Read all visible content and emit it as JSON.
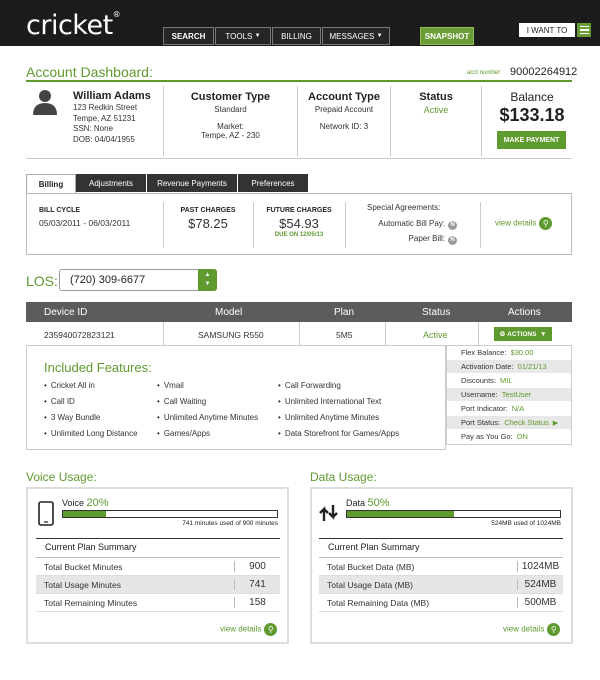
{
  "header": {
    "logo": "cricket",
    "logo_mark": "®",
    "nav": [
      "SEARCH",
      "TOOLS",
      "BILLING",
      "MESSAGES"
    ],
    "snapshot": "SNAPSHOT",
    "i_want_to": "I WANT TO",
    "tools_caret": "▼",
    "messages_caret": "▼"
  },
  "dashboard": {
    "title": "Account Dashboard:",
    "acct_label": "acct number:",
    "acct_number": "90002264912"
  },
  "customer": {
    "name": "William Adams",
    "street": "123 Redkin Street",
    "city": "Tempe, AZ 51231",
    "ssn": "SSN: None",
    "dob": "DOB: 04/04/1955"
  },
  "customer_type": {
    "label": "Customer Type",
    "value": "Standard",
    "market_label": "Market:",
    "market_value": "Tempe, AZ -  230"
  },
  "account_type": {
    "label": "Account Type",
    "value": "Prepaid Account",
    "network": "Network ID: 3"
  },
  "status": {
    "label": "Status",
    "value": "Active"
  },
  "balance": {
    "label": "Balance",
    "value": "$133.18",
    "button": "MAKE PAYMENT"
  },
  "tabs": [
    "Billing",
    "Adjustments",
    "Revenue Payments",
    "Preferences"
  ],
  "billing": {
    "cycle_label": "BILL CYCLE",
    "cycle_value": "05/03/2011 - 06/03/2011",
    "past_label": "PAST CHARGES",
    "past_value": "$78.25",
    "future_label": "FUTURE CHARGES",
    "future_value": "$54.93",
    "future_due": "DUE ON 12/05/13",
    "special_label": "Special Agreements:",
    "autopay_label": "Automatic Bill Pay:",
    "paper_label": "Paper Bill:",
    "badge": "N",
    "view_details": "view details"
  },
  "los": {
    "label": "LOS:",
    "value": "(720) 309-6677"
  },
  "device_table": {
    "headers": [
      "Device ID",
      "Model",
      "Plan",
      "Status",
      "Actions"
    ],
    "row": {
      "device_id": "235940072823121",
      "model": "SAMSUNG R550",
      "plan": "5M5",
      "status": "Active",
      "action": "ACTIONS"
    }
  },
  "features": {
    "title": "Included Features:",
    "col1": [
      "Cricket All in",
      "Call ID",
      "3 Way Bundle",
      "Unlimited Long Distance"
    ],
    "col2": [
      "Vmail",
      "Call Waiting",
      "Unlimited Anytime Minutes",
      "Games/Apps"
    ],
    "col3": [
      "Call Forwarding",
      "Unlimited International Text",
      "Unlimited Anytime Minutes",
      "Data Storefront for Games/Apps"
    ]
  },
  "side_info": [
    {
      "label": "Flex Balance:",
      "value": "$30.00"
    },
    {
      "label": "Activation Date:",
      "value": "01/21/13"
    },
    {
      "label": "Discounts:",
      "value": "MIL"
    },
    {
      "label": "Username:",
      "value": "TestUser"
    },
    {
      "label": "Port Indicator:",
      "value": "N/A"
    },
    {
      "label": "Port Status:",
      "value": "Check Status"
    },
    {
      "label": "Pay as You Go:",
      "value": "ON"
    }
  ],
  "voice": {
    "title": "Voice Usage:",
    "label": "Voice",
    "percent_text": "20%",
    "percent": 20,
    "caption": "741 minutes used of 900 minutes",
    "summary_title": "Current Plan Summary",
    "rows": [
      {
        "label": "Total Bucket Minutes",
        "value": "900"
      },
      {
        "label": "Total Usage Minutes",
        "value": "741"
      },
      {
        "label": "Total Remaining Minutes",
        "value": "158"
      }
    ],
    "view_details": "view details"
  },
  "data": {
    "title": "Data Usage:",
    "label": "Data",
    "percent_text": "50%",
    "percent": 50,
    "caption": "524MB used of 1024MB",
    "summary_title": "Current Plan Summary",
    "rows": [
      {
        "label": "Total Bucket Data (MB)",
        "value": "1024MB"
      },
      {
        "label": "Total Usage Data (MB)",
        "value": "524MB"
      },
      {
        "label": "Total Remaining Data (MB)",
        "value": "500MB"
      }
    ],
    "view_details": "view details"
  },
  "colors": {
    "accent": "#5f9a2f",
    "topbar": "#1c1c1c"
  }
}
